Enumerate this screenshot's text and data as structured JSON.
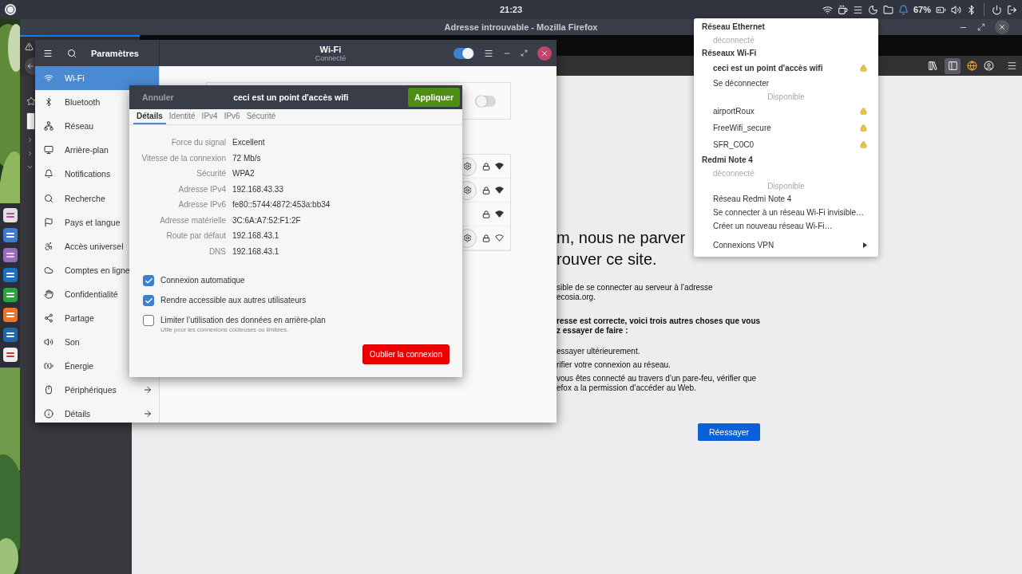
{
  "top_bar": {
    "clock": "21:23",
    "battery": "67%"
  },
  "firefox": {
    "title": "Adresse introuvable - Mozilla Firefox",
    "sidebar_button_active": true,
    "error_page": {
      "heading": [
        "m, nous ne parver",
        "rouver ce site."
      ],
      "intro": [
        "sible de se connecter au serveur à l’adresse",
        "ecosia.org."
      ],
      "advice": [
        "resse est correcte, voici trois autres choses que vous",
        "z essayer de faire :"
      ],
      "suggestions": [
        [
          "essayer ultérieurement."
        ],
        [
          "rifier votre connexion au réseau."
        ],
        [
          "vous êtes connecté au travers d’un pare-feu, vérifier que",
          "efox a la permission d’accéder au Web."
        ]
      ],
      "retry_button": "Réessayer"
    }
  },
  "settings": {
    "title": "Paramètres",
    "page_title": "Wi-Fi",
    "page_subtitle": "Connecté",
    "wifi_on": true,
    "airplane_mode_on": false,
    "sidebar": [
      {
        "label": "Wi-Fi",
        "selected": true
      },
      {
        "label": "Bluetooth",
        "selected": false
      },
      {
        "label": "Réseau",
        "selected": false
      },
      {
        "label": "Arrière-plan",
        "selected": false
      },
      {
        "label": "Notifications",
        "selected": false
      },
      {
        "label": "Recherche",
        "selected": false
      },
      {
        "label": "Pays et langue",
        "selected": false
      },
      {
        "label": "Accès universel",
        "selected": false
      },
      {
        "label": "Comptes en ligne",
        "selected": false
      },
      {
        "label": "Confidentialité",
        "selected": false
      },
      {
        "label": "Partage",
        "selected": false
      },
      {
        "label": "Son",
        "selected": false
      },
      {
        "label": "Énergie",
        "selected": false
      },
      {
        "label": "Périphériques",
        "selected": false,
        "has_arrow": true
      },
      {
        "label": "Détails",
        "selected": false,
        "has_arrow": true
      }
    ],
    "networks": [
      {
        "has_settings": true,
        "strong_signal": true
      },
      {
        "has_settings": true,
        "strong_signal": true
      },
      {
        "has_settings": false,
        "strong_signal": true
      },
      {
        "has_settings": true,
        "strong_signal": false
      }
    ]
  },
  "connection_dialog": {
    "cancel_button": "Annuler",
    "title": "ceci est un point d'accès wifi",
    "apply_button": "Appliquer",
    "tabs": [
      {
        "label": "Détails",
        "selected": true
      },
      {
        "label": "Identité",
        "selected": false
      },
      {
        "label": "IPv4",
        "selected": false
      },
      {
        "label": "IPv6",
        "selected": false
      },
      {
        "label": "Sécurité",
        "selected": false
      }
    ],
    "details": [
      {
        "label": "Force du signal",
        "value": "Excellent"
      },
      {
        "label": "Vitesse de la connexion",
        "value": "72 Mb/s"
      },
      {
        "label": "Sécurité",
        "value": "WPA2"
      },
      {
        "label": "Adresse IPv4",
        "value": "192.168.43.33"
      },
      {
        "label": "Adresse IPv6",
        "value": "fe80::5744:4872:453a:bb34"
      },
      {
        "label": "Adresse matérielle",
        "value": "3C:6A:A7:52:F1:2F"
      },
      {
        "label": "Route par défaut",
        "value": "192.168.43.1"
      },
      {
        "label": "DNS",
        "value": "192.168.43.1"
      }
    ],
    "options": [
      {
        "label": "Connexion automatique",
        "checked": true
      },
      {
        "label": "Rendre accessible aux autres utilisateurs",
        "checked": true
      },
      {
        "label": "Limiter l’utilisation des données en arrière-plan",
        "hint": "Utile pour les connexions coûteuses ou limitées.",
        "checked": false
      }
    ],
    "forget_button": "Oublier la connexion"
  },
  "network_menu": {
    "items": [
      {
        "kind": "header",
        "label": "Réseau Ethernet"
      },
      {
        "kind": "status",
        "label": "déconnecté"
      },
      {
        "kind": "header",
        "label": "Réseaux Wi-Fi"
      },
      {
        "kind": "network",
        "label": "ceci est un point d'accès wifi",
        "active": true,
        "secured": true
      },
      {
        "kind": "action",
        "label": "Se déconnecter"
      },
      {
        "kind": "section",
        "label": "Disponible"
      },
      {
        "kind": "network",
        "label": "airportRoux",
        "active": false,
        "secured": true
      },
      {
        "kind": "network",
        "label": "FreeWifi_secure",
        "active": false,
        "secured": true
      },
      {
        "kind": "network",
        "label": "SFR_C0C0",
        "active": false,
        "secured": true
      },
      {
        "kind": "header",
        "label": "Redmi Note 4"
      },
      {
        "kind": "status",
        "label": "déconnecté"
      },
      {
        "kind": "section",
        "label": "Disponible"
      },
      {
        "kind": "action",
        "label": "Réseau Redmi Note 4"
      },
      {
        "kind": "action",
        "label": "Se connecter à un réseau Wi-Fi invisible…"
      },
      {
        "kind": "action",
        "label": "Créer un nouveau réseau Wi-Fi…"
      },
      {
        "kind": "submenu",
        "label": "Connexions VPN"
      }
    ]
  }
}
